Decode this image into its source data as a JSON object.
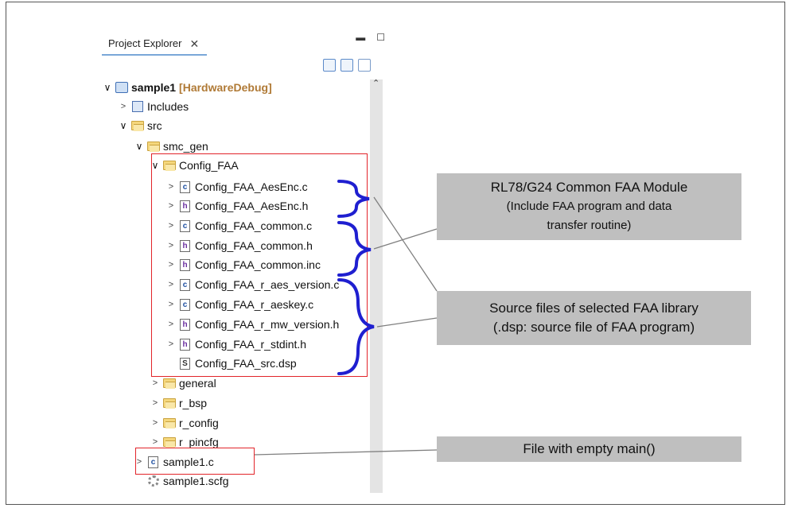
{
  "explorer": {
    "tab_label": "Project Explorer",
    "tree": {
      "project_name": "sample1",
      "project_tag": "[HardwareDebug]",
      "includes": "Includes",
      "src": "src",
      "smc_gen": "smc_gen",
      "config_faa": "Config_FAA",
      "files": [
        {
          "name": "Config_FAA_AesEnc.c",
          "type": "c"
        },
        {
          "name": "Config_FAA_AesEnc.h",
          "type": "h"
        },
        {
          "name": "Config_FAA_common.c",
          "type": "c"
        },
        {
          "name": "Config_FAA_common.h",
          "type": "h"
        },
        {
          "name": "Config_FAA_common.inc",
          "type": "h"
        },
        {
          "name": "Config_FAA_r_aes_version.c",
          "type": "c"
        },
        {
          "name": "Config_FAA_r_aeskey.c",
          "type": "c"
        },
        {
          "name": "Config_FAA_r_mw_version.h",
          "type": "h"
        },
        {
          "name": "Config_FAA_r_stdint.h",
          "type": "h"
        },
        {
          "name": "Config_FAA_src.dsp",
          "type": "S"
        }
      ],
      "other_folders": [
        "general",
        "r_bsp",
        "r_config",
        "r_pincfg"
      ],
      "main_file": "sample1.c",
      "scfg_file": "sample1.scfg"
    }
  },
  "callouts": {
    "common_module": [
      "RL78/G24 Common FAA Module",
      "(Include FAA program and data",
      "transfer routine)"
    ],
    "source_files": [
      "Source files of selected FAA library",
      "(.dsp: source file of FAA program)"
    ],
    "empty_main": "File with empty main()"
  },
  "colors": {
    "brace": "#1f1fd0",
    "highlight_box": "#e2242a",
    "callout_bg": "#bfbfbf"
  }
}
